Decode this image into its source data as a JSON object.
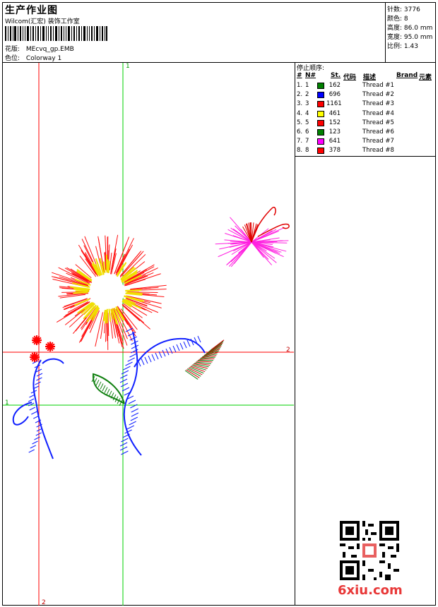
{
  "header": {
    "title": "生产作业图",
    "subtitle": "Wilcom(汇宏) 装饰工作室",
    "pattern_label": "花版:",
    "pattern_value": "MEcvq_gp.EMB",
    "colorway_label": "色位:",
    "colorway_value": "Colorway 1"
  },
  "stats": [
    {
      "label": "针数:",
      "value": "3776"
    },
    {
      "label": "颜色:",
      "value": "8"
    },
    {
      "label": "高度:",
      "value": "86.0 mm"
    },
    {
      "label": "宽度:",
      "value": "95.0 mm"
    },
    {
      "label": "比例:",
      "value": "1.43"
    }
  ],
  "stop_sequence": {
    "title": "停止顺序:",
    "headers": {
      "num": "#",
      "needle": "N#",
      "stitches": "St.",
      "code": "代码",
      "desc": "描述",
      "brand": "Brand",
      "element": "元素"
    },
    "rows": [
      {
        "num": "1.",
        "needle": "1",
        "color": "#008000",
        "stitches": "162",
        "desc": "Thread #1"
      },
      {
        "num": "2.",
        "needle": "2",
        "color": "#0000ff",
        "stitches": "696",
        "desc": "Thread #2"
      },
      {
        "num": "3.",
        "needle": "3",
        "color": "#ff0000",
        "stitches": "1161",
        "desc": "Thread #3"
      },
      {
        "num": "4.",
        "needle": "4",
        "color": "#ffff00",
        "stitches": "461",
        "desc": "Thread #4"
      },
      {
        "num": "5.",
        "needle": "5",
        "color": "#ff0000",
        "stitches": "152",
        "desc": "Thread #5"
      },
      {
        "num": "6.",
        "needle": "6",
        "color": "#008000",
        "stitches": "123",
        "desc": "Thread #6"
      },
      {
        "num": "7.",
        "needle": "7",
        "color": "#ff00ff",
        "stitches": "641",
        "desc": "Thread #7"
      },
      {
        "num": "8.",
        "needle": "8",
        "color": "#ff0000",
        "stitches": "378",
        "desc": "Thread #8"
      }
    ]
  },
  "axes": {
    "green_1": "1",
    "green_v1": "1",
    "red_2": "2",
    "red_v2": "2"
  },
  "footer": {
    "brand": "6xiu.com"
  }
}
